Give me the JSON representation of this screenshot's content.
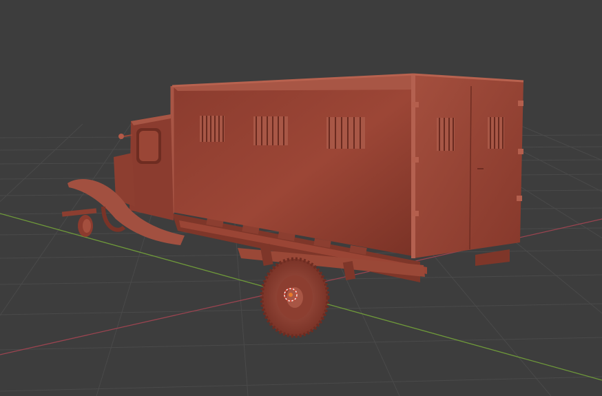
{
  "viewport": {
    "background_color": "#3d3d3d",
    "grid_color": "#4a4a4a",
    "x_axis_color": "#9b4450",
    "y_axis_color": "#6f9a3a",
    "model_color": "#9e4a3a",
    "origin_marker_color": "#e87a2a",
    "view": "perspective",
    "shading": "solid",
    "object": {
      "icon": "truck-icon",
      "description_visible": false
    }
  }
}
